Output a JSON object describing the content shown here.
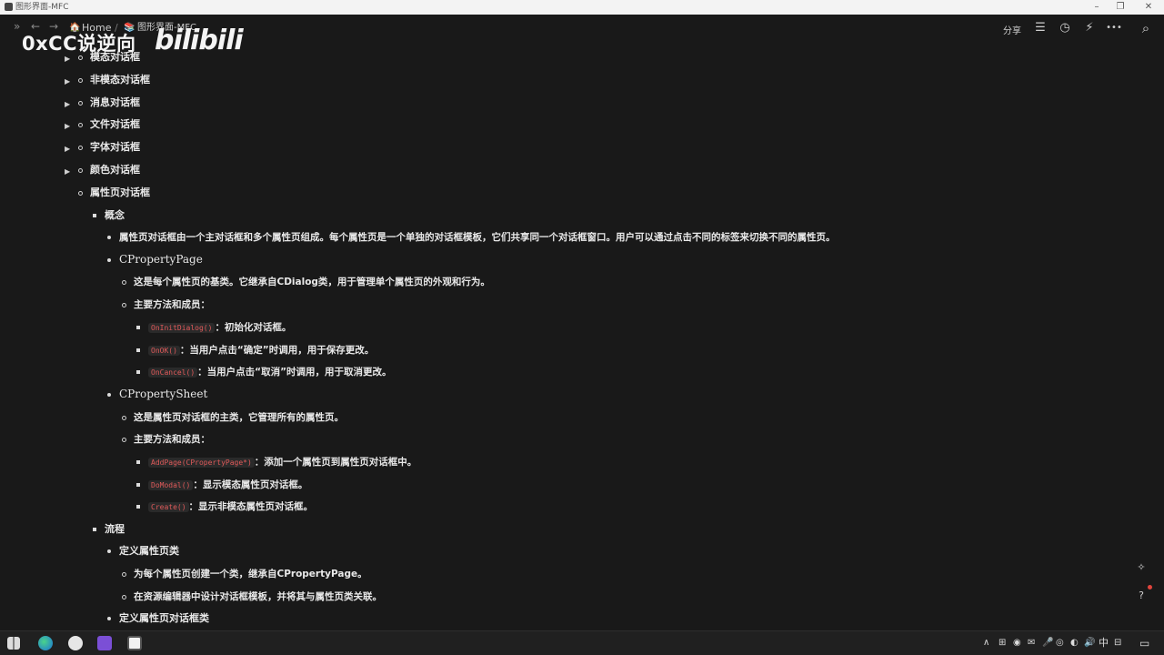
{
  "window": {
    "title": "图形界面-MFC"
  },
  "window_controls": {
    "minimize": "–",
    "restore": "❐",
    "close": "✕"
  },
  "nav": {
    "sidebar_toggle": "»",
    "back": "←",
    "forward": "→"
  },
  "breadcrumb": {
    "home_icon": "🏠",
    "home": "Home",
    "separator": "/",
    "page_icon": "📚",
    "page": "图形界面-MFC"
  },
  "topbar": {
    "share": "分享",
    "comment_icon": "☰",
    "history_icon": "◷",
    "ai_icon": "⚡",
    "more_icon": "•••",
    "search_icon": "⌕"
  },
  "watermark": {
    "text": "0xCC说逆向",
    "brand": "bilibili"
  },
  "doc": {
    "items": [
      {
        "text": "模态对话框"
      },
      {
        "text": "非模态对话框"
      },
      {
        "text": "消息对话框"
      },
      {
        "text": "文件对话框"
      },
      {
        "text": "字体对话框"
      },
      {
        "text": "颜色对话框"
      },
      {
        "text": "属性页对话框"
      },
      {
        "text": "概念"
      },
      {
        "text": "属性页对话框由一个主对话框和多个属性页组成。每个属性页是一个单独的对话框模板，它们共享同一个对话框窗口。用户可以通过点击不同的标签来切换不同的属性页。"
      },
      {
        "text": "CPropertyPage"
      },
      {
        "text": "这是每个属性页的基类。它继承自CDialog类，用于管理单个属性页的外观和行为。"
      },
      {
        "text": "主要方法和成员："
      },
      {
        "code": "OnInitDialog()",
        "text": "：初始化对话框。"
      },
      {
        "code": "OnOK()",
        "text": "：当用户点击“确定”时调用，用于保存更改。"
      },
      {
        "code": "OnCancel()",
        "text": "：当用户点击“取消”时调用，用于取消更改。"
      },
      {
        "text": "CPropertySheet"
      },
      {
        "text": "这是属性页对话框的主类，它管理所有的属性页。"
      },
      {
        "text": "主要方法和成员："
      },
      {
        "code": "AddPage(CPropertyPage*)",
        "text": "：添加一个属性页到属性页对话框中。"
      },
      {
        "code": "DoModal()",
        "text": "：显示模态属性页对话框。"
      },
      {
        "code": "Create()",
        "text": "：显示非模态属性页对话框。"
      },
      {
        "text": "流程"
      },
      {
        "text": "定义属性页类"
      },
      {
        "text": "为每个属性页创建一个类，继承自CPropertyPage。"
      },
      {
        "text": "在资源编辑器中设计对话框模板，并将其与属性页类关联。"
      },
      {
        "text": "定义属性页对话框类"
      }
    ]
  },
  "floating": {
    "ai_button": "✧",
    "help_button": "?"
  },
  "taskbar": {
    "tray_lang": "中",
    "tray_icons": [
      "∧",
      "⊞",
      "◉",
      "✉",
      "◎",
      "◍",
      "🎤",
      "◐",
      "🔊",
      "⊟"
    ],
    "notification_icon": "▭"
  }
}
